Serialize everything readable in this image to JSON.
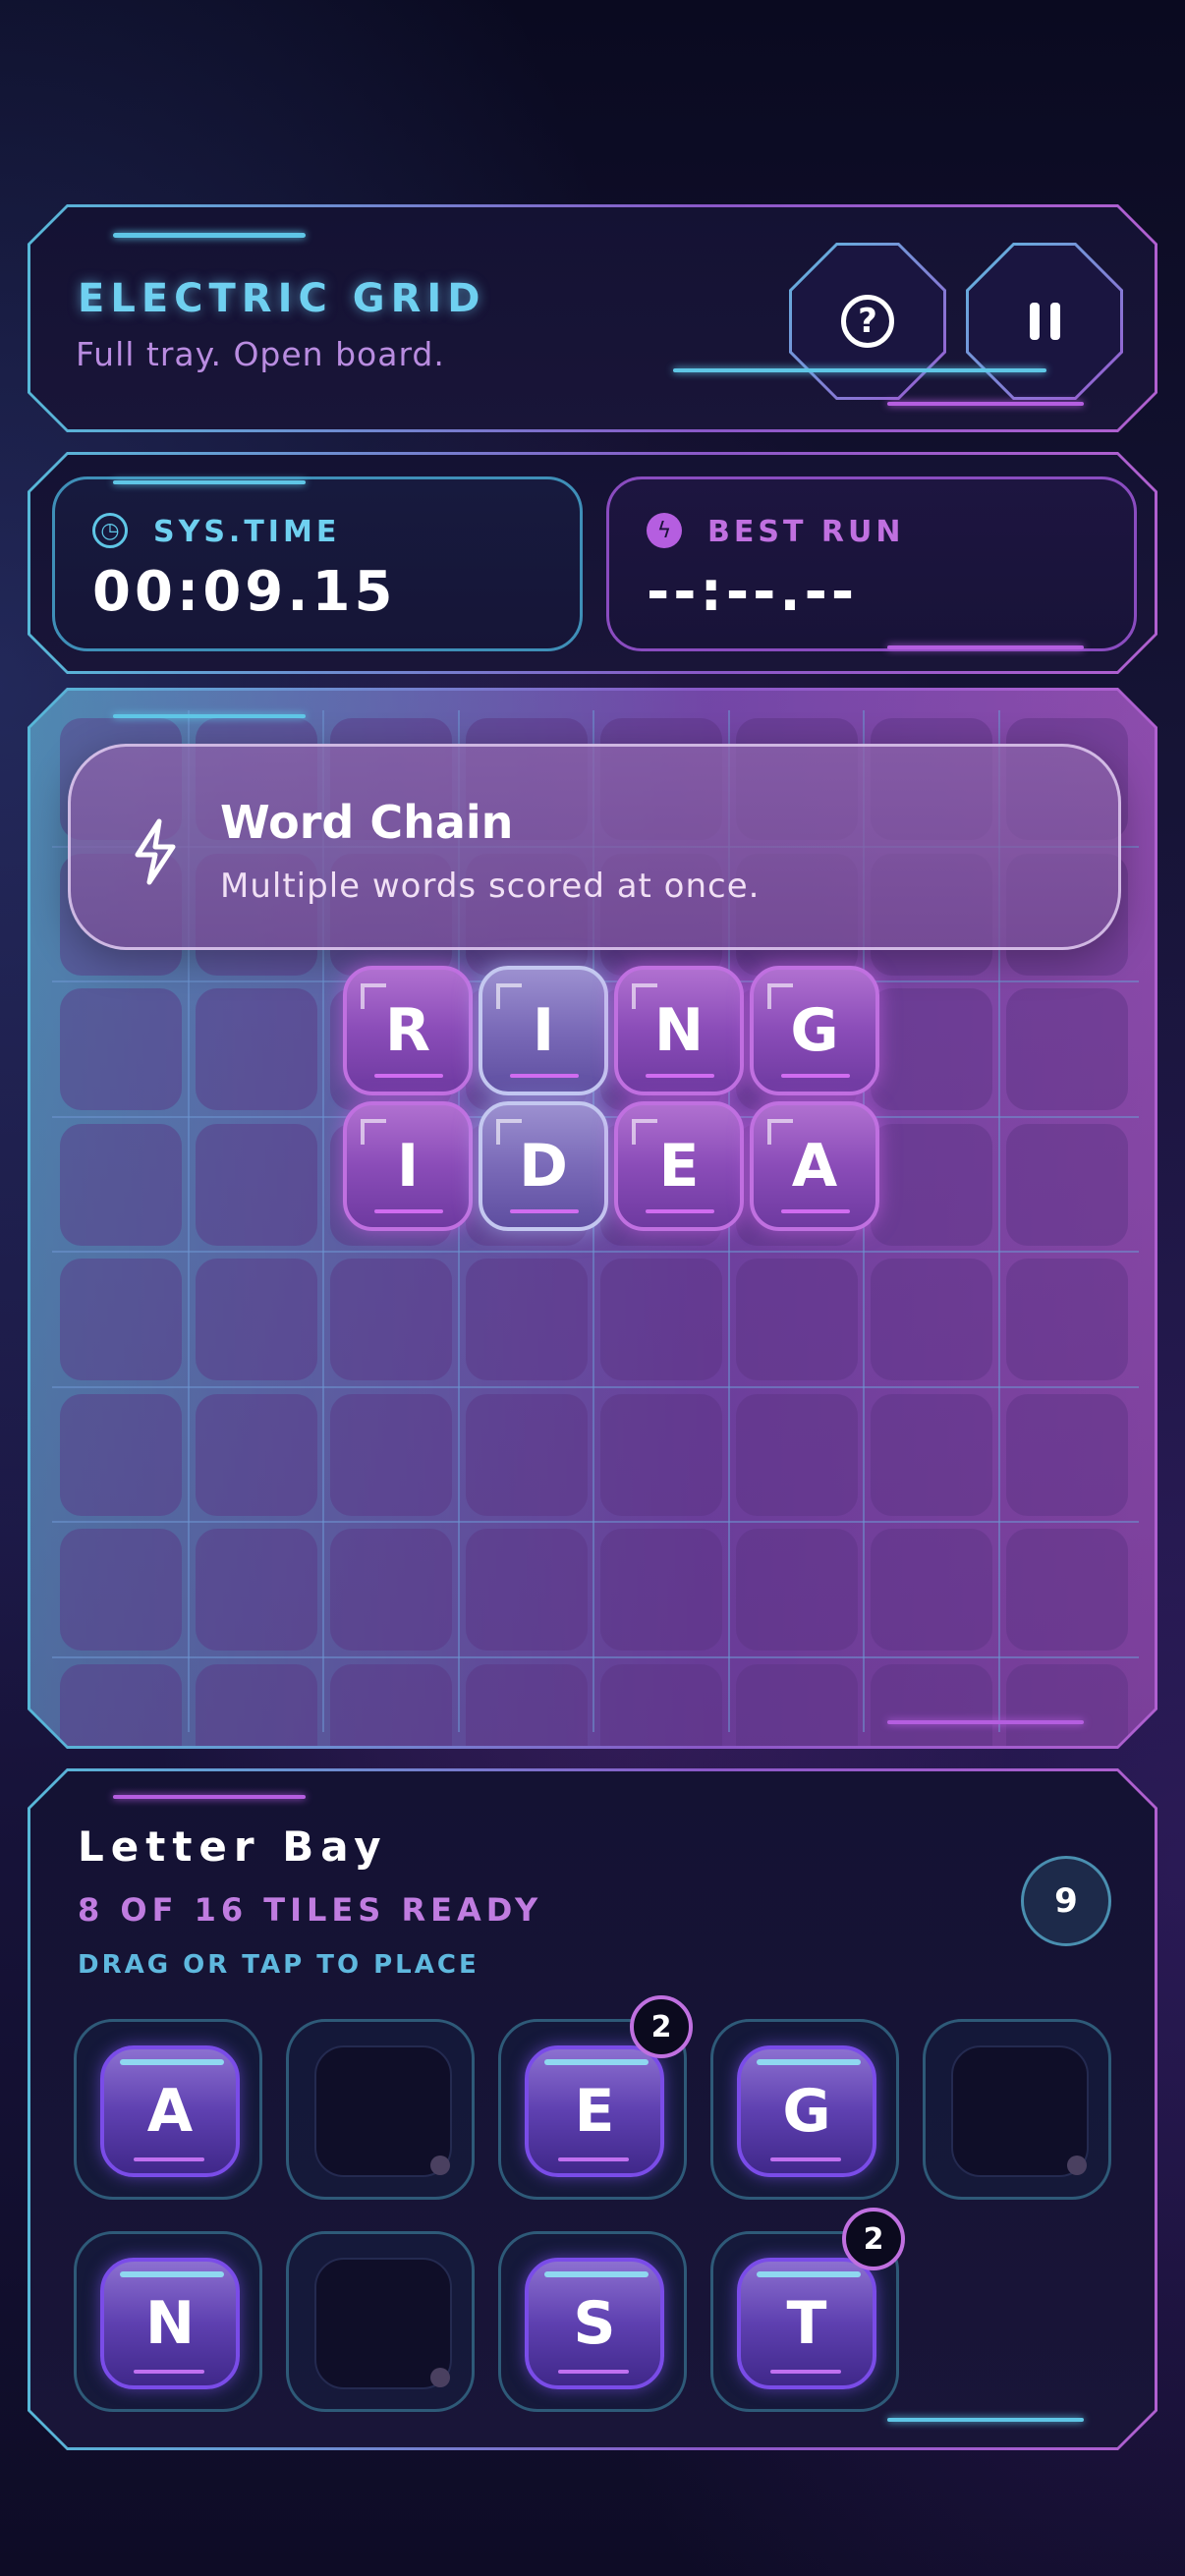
{
  "header": {
    "title": "ELECTRIC GRID",
    "subtitle": "Full tray. Open board.",
    "help_icon_label": "?"
  },
  "stats": {
    "time": {
      "label": "SYS.TIME",
      "value": "00:09.15",
      "icon": "timer-icon"
    },
    "best": {
      "label": "BEST RUN",
      "value": "--:--.--",
      "icon": "bolt-icon"
    }
  },
  "board": {
    "toast": {
      "title": "Word Chain",
      "subtitle": "Multiple words scored at once.",
      "icon": "lightning-icon"
    },
    "row1": [
      "R",
      "I",
      "N",
      "G"
    ],
    "row2": [
      "I",
      "D",
      "E",
      "A"
    ]
  },
  "bay": {
    "title": "Letter Bay",
    "ready": "8 OF 16 TILES READY",
    "hint": "DRAG OR TAP TO PLACE",
    "count": "9",
    "slots": [
      {
        "letter": "A",
        "badge": ""
      },
      {
        "letter": "",
        "badge": ""
      },
      {
        "letter": "E",
        "badge": "2"
      },
      {
        "letter": "G",
        "badge": ""
      },
      {
        "letter": "",
        "badge": ""
      },
      {
        "letter": "N",
        "badge": ""
      },
      {
        "letter": "",
        "badge": ""
      },
      {
        "letter": "S",
        "badge": ""
      },
      {
        "letter": "T",
        "badge": "2"
      }
    ]
  },
  "colors": {
    "cyan": "#5fc6e6",
    "violet": "#b55ee0",
    "background": "#0c0a24"
  }
}
